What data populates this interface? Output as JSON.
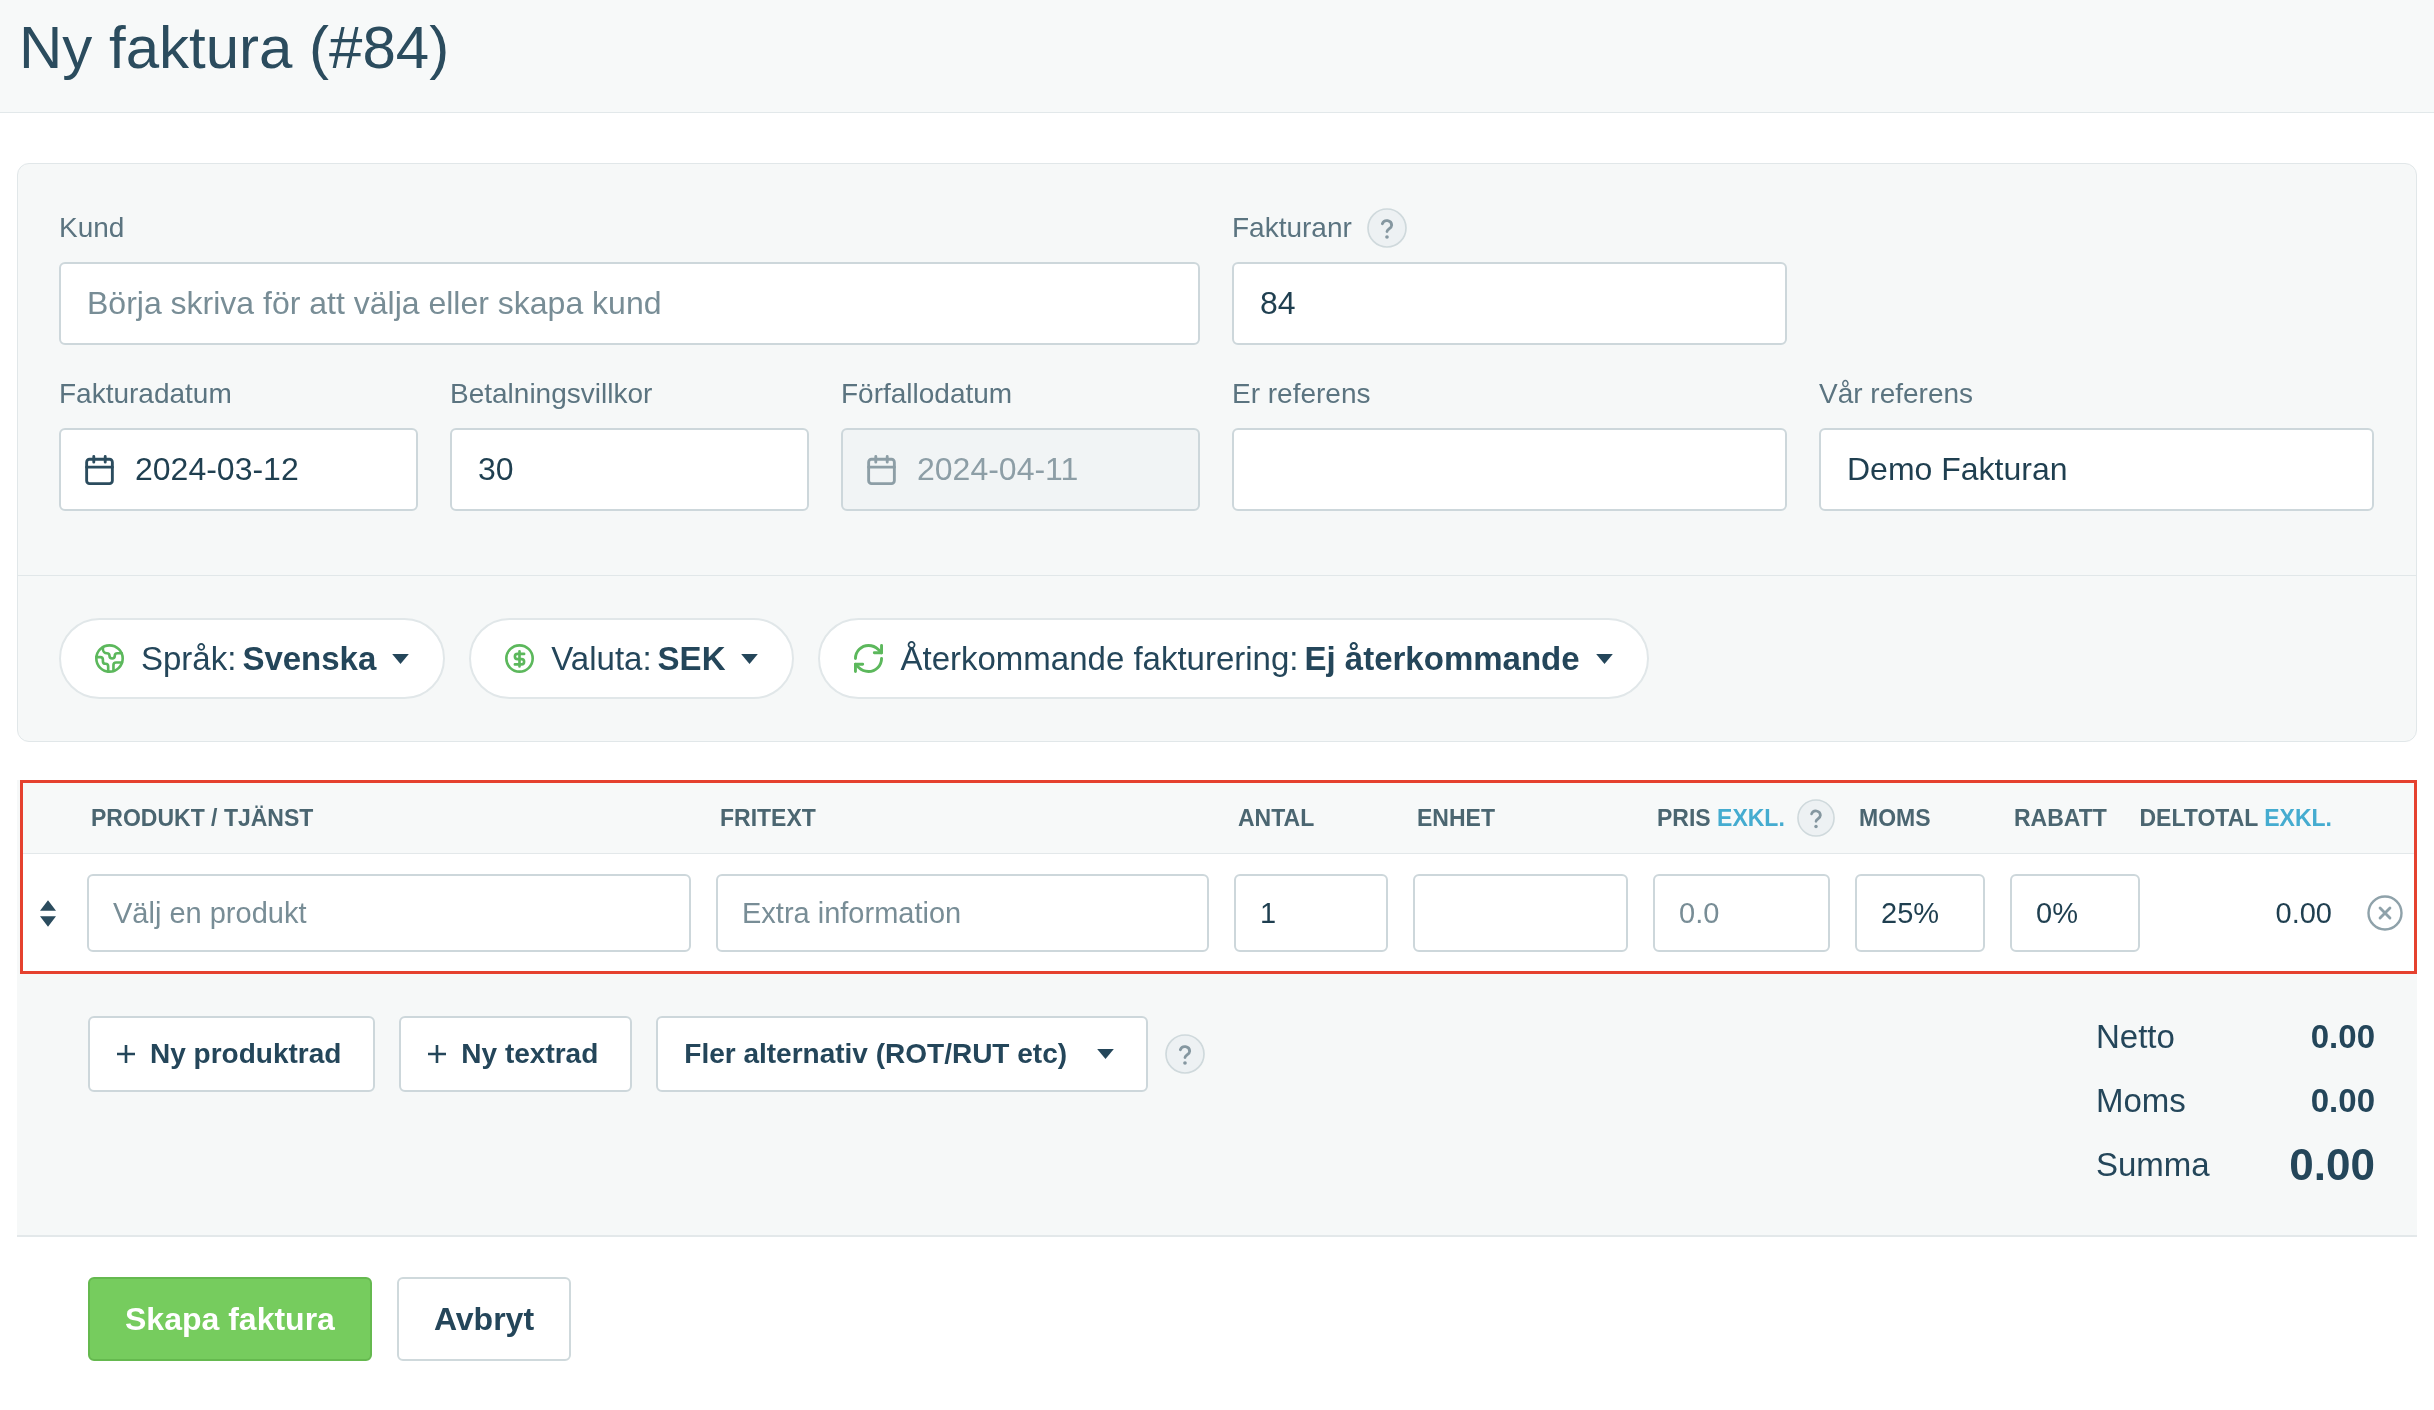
{
  "title": "Ny faktura (#84)",
  "form": {
    "rows": [
      {
        "fields": [
          {
            "label": "Kund",
            "kind": "text",
            "placeholder": "Börja skriva för att välja eller skapa kund",
            "help": false,
            "disabled": false
          },
          {
            "label": "Fakturanr",
            "kind": "text",
            "value": "84",
            "help": true,
            "disabled": false
          }
        ]
      },
      {
        "fields": [
          {
            "label": "Fakturadatum",
            "kind": "date",
            "value": "2024-03-12",
            "help": false,
            "disabled": false
          },
          {
            "label": "Betalningsvillkor",
            "kind": "text",
            "value": "30",
            "help": false,
            "disabled": false
          },
          {
            "label": "Förfallodatum",
            "kind": "date",
            "value": "2024-04-11",
            "help": false,
            "disabled": true
          },
          {
            "label": "Er referens",
            "kind": "text",
            "help": false,
            "disabled": false
          },
          {
            "label": "Vår referens",
            "kind": "text",
            "value": "Demo Fakturan",
            "help": false,
            "disabled": false
          }
        ]
      }
    ],
    "options": [
      {
        "label": "Språk:",
        "value": "Svenska"
      },
      {
        "label": "Valuta:",
        "value": "SEK"
      },
      {
        "label": "Återkommande fakturering:",
        "value": "Ej återkommande"
      }
    ]
  },
  "table": {
    "columns": [
      {
        "label": "PRODUKT / TJÄNST",
        "help": false
      },
      {
        "label": "FRITEXT",
        "help": false
      },
      {
        "label": "ANTAL",
        "help": false
      },
      {
        "label": "ENHET",
        "help": false
      },
      {
        "label": "PRIS",
        "note": "EXKL.",
        "help": true
      },
      {
        "label": "MOMS",
        "help": false
      },
      {
        "label": "RABATT",
        "help": false
      },
      {
        "label": "DELTOTAL",
        "note": "EXKL.",
        "help": false
      }
    ],
    "rows": [
      {
        "cells": [
          {
            "kind": "input",
            "placeholder": "Välj en produkt"
          },
          {
            "kind": "input",
            "placeholder": "Extra information"
          },
          {
            "kind": "input",
            "value": "1"
          },
          {
            "kind": "input"
          },
          {
            "kind": "input",
            "placeholder": "0.0"
          },
          {
            "kind": "input",
            "value": "25%"
          },
          {
            "kind": "input",
            "value": "0%"
          },
          {
            "kind": "text",
            "value": "0.00"
          }
        ]
      }
    ]
  },
  "actions": [
    {
      "label": "Ny produktrad",
      "kind": "add"
    },
    {
      "label": "Ny textrad",
      "kind": "add"
    },
    {
      "label": "Fler alternativ (ROT/RUT etc)",
      "kind": "dropdown"
    }
  ],
  "totals": [
    {
      "label": "Netto",
      "value": "0.00",
      "kind": "line"
    },
    {
      "label": "Moms",
      "value": "0.00",
      "kind": "line"
    },
    {
      "label": "Summa",
      "value": "0.00",
      "kind": "grand"
    }
  ],
  "buttons": [
    {
      "label": "Skapa faktura",
      "kind": "primary"
    },
    {
      "label": "Avbryt",
      "kind": "secondary"
    }
  ]
}
